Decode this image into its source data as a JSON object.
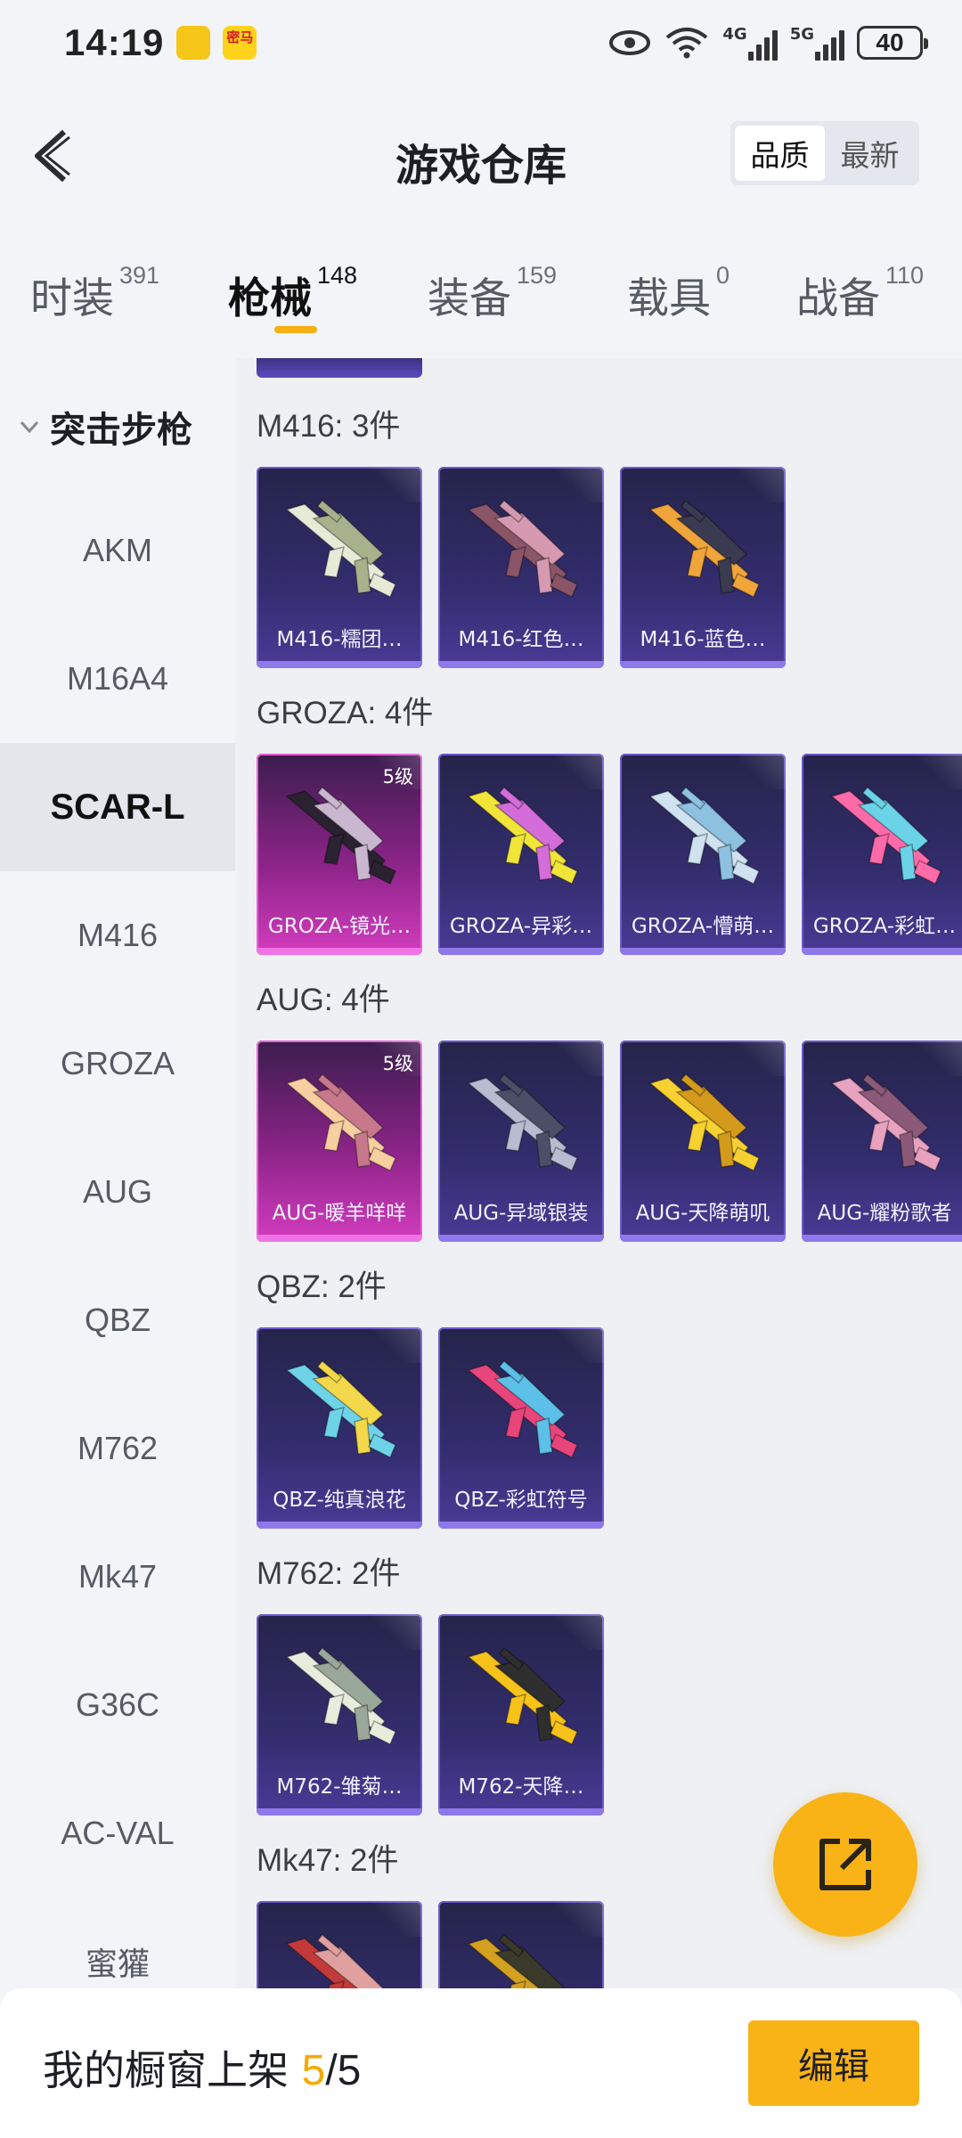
{
  "status_bar": {
    "time": "14:19",
    "app_icon_1": "",
    "app_icon_2": "密马",
    "net_1": "4G",
    "net_2": "5G",
    "battery": "40"
  },
  "header": {
    "title": "游戏仓库",
    "sort_options": [
      "品质",
      "最新"
    ],
    "sort_active": "品质"
  },
  "tabs": [
    {
      "label": "时装",
      "count": "391"
    },
    {
      "label": "枪械",
      "count": "148"
    },
    {
      "label": "装备",
      "count": "159"
    },
    {
      "label": "载具",
      "count": "0"
    },
    {
      "label": "战备",
      "count": "110"
    }
  ],
  "active_tab": "枪械",
  "sidebar": {
    "category": "突击步枪",
    "items": [
      "AKM",
      "M16A4",
      "SCAR-L",
      "M416",
      "GROZA",
      "AUG",
      "QBZ",
      "M762",
      "Mk47",
      "G36C",
      "AC-VAL",
      "蜜獾"
    ],
    "active": "SCAR-L"
  },
  "sections": [
    {
      "title": "M416: 3件",
      "items": [
        {
          "name": "M416-糯团…",
          "grade": "",
          "colors": [
            "#e8ead8",
            "#a7b28c"
          ]
        },
        {
          "name": "M416-红色…",
          "grade": "",
          "colors": [
            "#8a5566",
            "#d69ab0"
          ]
        },
        {
          "name": "M416-蓝色…",
          "grade": "",
          "colors": [
            "#f0a53a",
            "#3a3a50"
          ]
        }
      ]
    },
    {
      "title": "GROZA: 4件",
      "items": [
        {
          "name": "GROZA-镜光…",
          "grade": "5级",
          "colors": [
            "#2a2230",
            "#c9b7d0"
          ]
        },
        {
          "name": "GROZA-异彩…",
          "grade": "",
          "colors": [
            "#f2e53a",
            "#d46cd9"
          ]
        },
        {
          "name": "GROZA-懵萌…",
          "grade": "",
          "colors": [
            "#cfe2ef",
            "#8ec0e0"
          ]
        },
        {
          "name": "GROZA-彩虹…",
          "grade": "",
          "colors": [
            "#ff6ba8",
            "#6bd3e8"
          ]
        }
      ]
    },
    {
      "title": "AUG: 4件",
      "items": [
        {
          "name": "AUG-暖羊咩咩",
          "grade": "5级",
          "colors": [
            "#f7cfa0",
            "#c7788a"
          ]
        },
        {
          "name": "AUG-异域银装",
          "grade": "",
          "colors": [
            "#b9bcd0",
            "#4c4d66"
          ]
        },
        {
          "name": "AUG-天降萌叽",
          "grade": "",
          "colors": [
            "#f7d032",
            "#d49a1c"
          ]
        },
        {
          "name": "AUG-耀粉歌者",
          "grade": "",
          "colors": [
            "#e8a2c0",
            "#8a5a78"
          ]
        }
      ]
    },
    {
      "title": "QBZ: 2件",
      "items": [
        {
          "name": "QBZ-纯真浪花",
          "grade": "",
          "colors": [
            "#6fd3e8",
            "#f2d84a"
          ]
        },
        {
          "name": "QBZ-彩虹符号",
          "grade": "",
          "colors": [
            "#e8457a",
            "#5cc0e8"
          ]
        }
      ]
    },
    {
      "title": "M762: 2件",
      "items": [
        {
          "name": "M762-雏菊…",
          "grade": "",
          "colors": [
            "#e8ecdc",
            "#9aa89a"
          ]
        },
        {
          "name": "M762-天降…",
          "grade": "",
          "colors": [
            "#f7c21a",
            "#2e2e2e"
          ]
        }
      ]
    },
    {
      "title": "Mk47: 2件",
      "items": [
        {
          "name": "",
          "grade": "",
          "colors": [
            "#c23a3a",
            "#e0a0a0"
          ]
        },
        {
          "name": "",
          "grade": "",
          "colors": [
            "#d4a020",
            "#3a3a2a"
          ]
        }
      ]
    }
  ],
  "bottom_bar": {
    "label": "我的橱窗上架",
    "count_current": "5",
    "count_separator": "/",
    "count_total": "5",
    "edit_label": "编辑"
  },
  "colors": {
    "accent": "#f9b316",
    "card_blue": "#332d6e",
    "card_pink": "#d33cbe"
  }
}
